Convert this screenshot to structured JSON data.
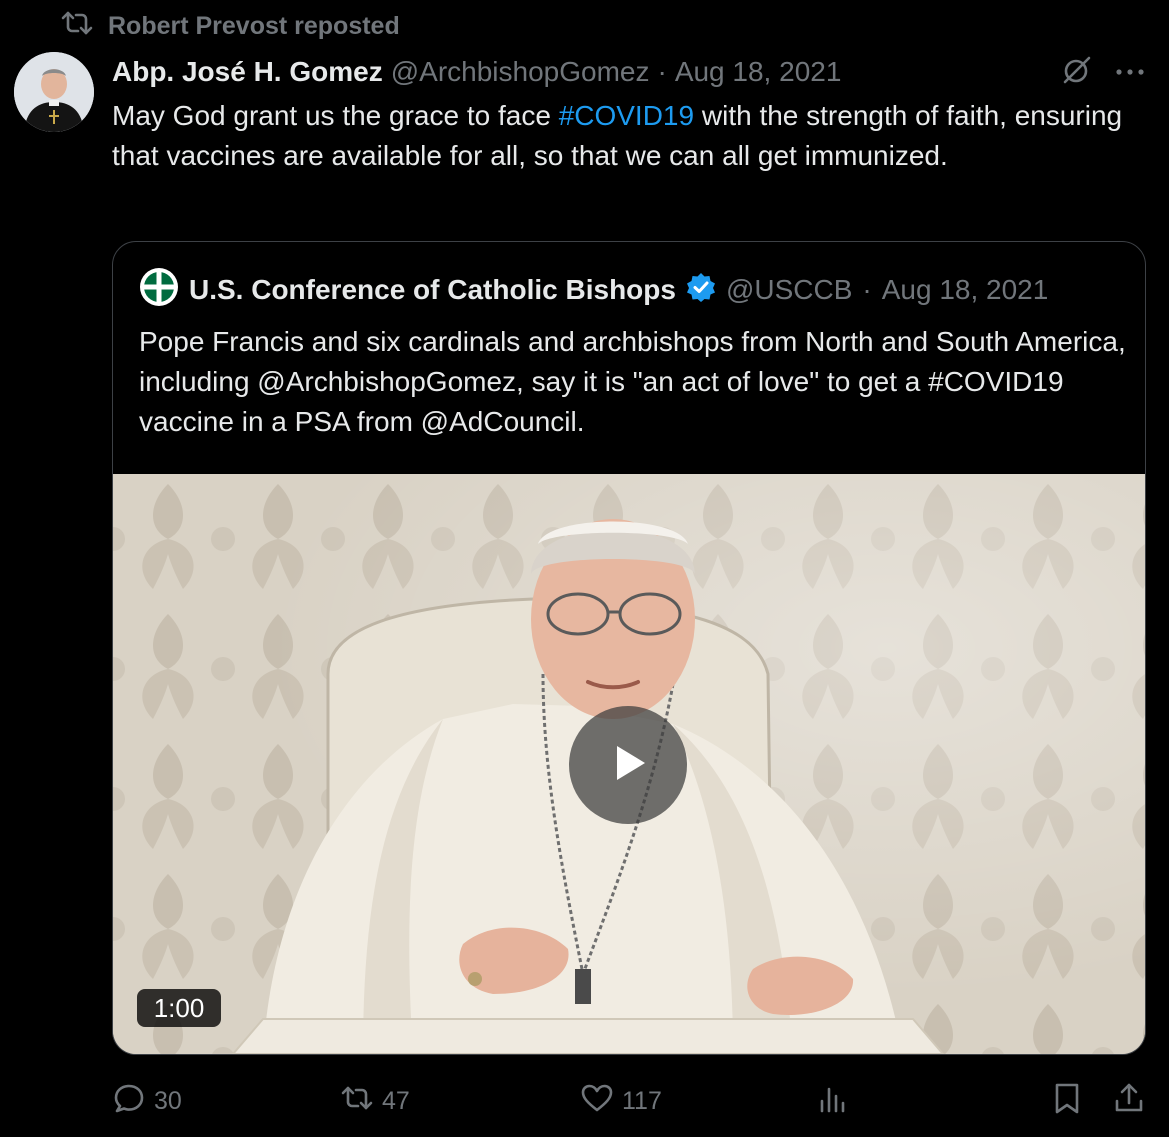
{
  "repost": {
    "label": "Robert Prevost reposted"
  },
  "tweet": {
    "author_name": "Abp. José H. Gomez",
    "handle": "@ArchbishopGomez",
    "separator": "·",
    "date": "Aug 18, 2021",
    "text_before": "May God grant us the grace to face ",
    "hashtag": "#COVID19",
    "text_after": " with the strength of faith, ensuring that vaccines are available for all, so that we can all get immunized."
  },
  "quoted": {
    "author_name": "U.S. Conference of Catholic Bishops",
    "handle": "@USCCB",
    "separator": "·",
    "date": "Aug 18, 2021",
    "text": "Pope Francis and six cardinals and archbishops from North and South America, including @ArchbishopGomez, say it is \"an act of love\" to get a #COVID19 vaccine in a PSA from @AdCouncil.",
    "video": {
      "duration": "1:00"
    }
  },
  "actions": {
    "replies": "30",
    "reposts": "47",
    "likes": "117"
  },
  "colors": {
    "background": "#000000",
    "text": "#e7e9ea",
    "muted": "#71767b",
    "link": "#1d9bf0",
    "verified": "#1d9bf0",
    "usccb_green": "#006b3f"
  },
  "icons": [
    "repost-icon",
    "grok-icon",
    "more-icon",
    "verified-badge-icon",
    "play-icon",
    "reply-icon",
    "like-icon",
    "views-icon",
    "bookmark-icon",
    "share-icon"
  ]
}
